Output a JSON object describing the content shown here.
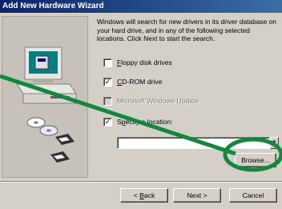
{
  "window": {
    "title": "Add New Hardware Wizard"
  },
  "description": "Windows will search for new drivers in its driver database on your hard drive, and in any of the following selected locations. Click Next to start the search.",
  "options": [
    {
      "label": "Floppy disk drives",
      "accesskey": "F",
      "rest": "loppy disk drives",
      "checked": false,
      "enabled": true
    },
    {
      "label": "CD-ROM drive",
      "accesskey": "C",
      "rest": "D-ROM drive",
      "checked": true,
      "enabled": true
    },
    {
      "label": "Microsoft Windows Update",
      "checked": false,
      "enabled": false
    },
    {
      "label": "Specify a location:",
      "pre": "S",
      "accesskey": "p",
      "rest": "ecify a location:",
      "checked": true,
      "enabled": true
    }
  ],
  "location": {
    "value": ""
  },
  "buttons": {
    "browse": "Browse...",
    "back_prefix": "< ",
    "back_key": "B",
    "back_rest": "ack",
    "next": "Next >",
    "cancel": "Cancel"
  },
  "colors": {
    "annotation": "#0f8a3a",
    "titlebar": "#0a246a"
  }
}
